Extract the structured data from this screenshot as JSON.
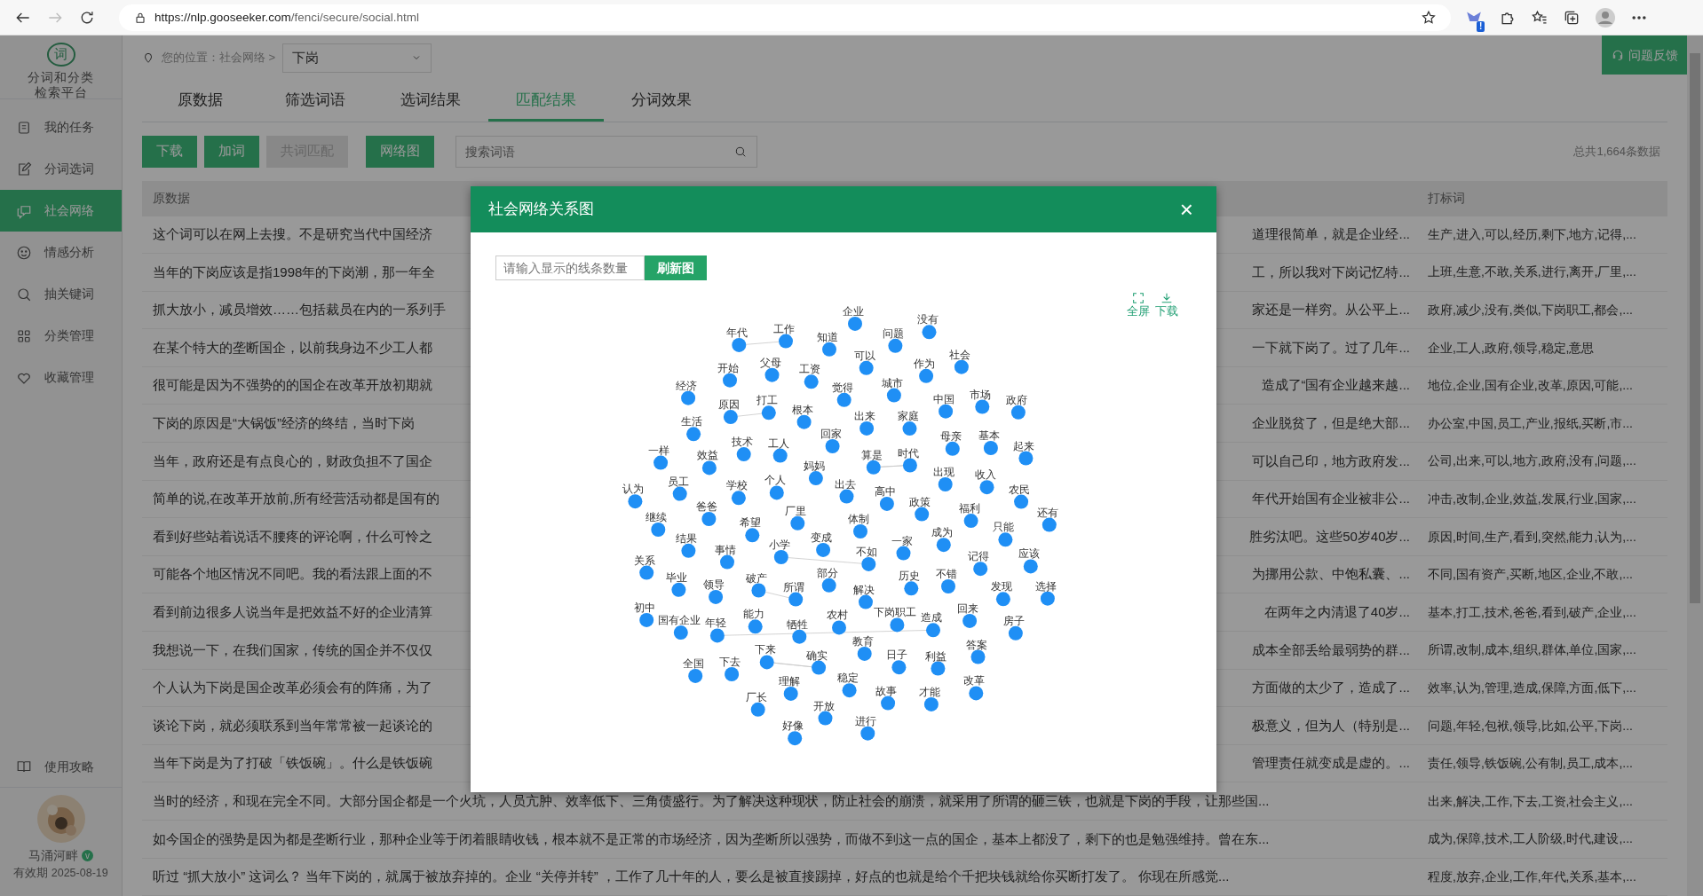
{
  "browser": {
    "url_host": "https://nlp.gooseeker.com",
    "url_path": "/fenci/secure/social.html",
    "badge": "!"
  },
  "sidebar": {
    "logo": "词",
    "title_lines": [
      "分词和分类",
      "检索平台"
    ],
    "items": [
      {
        "label": "我的任务",
        "selected": false
      },
      {
        "label": "分词选词",
        "selected": false
      },
      {
        "label": "社会网络",
        "selected": true
      },
      {
        "label": "情感分析",
        "selected": false
      },
      {
        "label": "抽关键词",
        "selected": false
      },
      {
        "label": "分类管理",
        "selected": false
      },
      {
        "label": "收藏管理",
        "selected": false
      }
    ],
    "help": "使用攻略",
    "user": {
      "name": "马涌河畔",
      "badge": "v",
      "expiry": "有效期 2025-08-19"
    }
  },
  "breadcrumb": {
    "label": "您的位置：社会网络 >",
    "select": "下岗"
  },
  "feedback": "问题反馈",
  "tabs": [
    {
      "label": "原数据",
      "selected": false
    },
    {
      "label": "筛选词语",
      "selected": false
    },
    {
      "label": "选词结果",
      "selected": false
    },
    {
      "label": "匹配结果",
      "selected": true
    },
    {
      "label": "分词效果",
      "selected": false
    }
  ],
  "toolbar": {
    "buttons": [
      {
        "label": "下载",
        "disabled": false
      },
      {
        "label": "加词",
        "disabled": false
      },
      {
        "label": "共词匹配",
        "disabled": true
      },
      {
        "label": "网络图",
        "disabled": false
      }
    ],
    "search_placeholder": "搜索词语",
    "total": "总共1,664条数据"
  },
  "table": {
    "columns": [
      "原数据",
      "打标词"
    ],
    "rows": [
      {
        "text_start": "这个词可以在网上去搜。不是研究当代中国经济",
        "text_end": "道理很简单，就是企业经...",
        "tags": "生产,进入,可以,经历,剩下,地方,记得,..."
      },
      {
        "text_start": "当年的下岗应该是指1998年的下岗潮，那一年全",
        "text_end": "工，所以我对下岗记忆特...",
        "tags": "上班,生意,不敢,关系,进行,离开,厂里,..."
      },
      {
        "text_start": "抓大放小，减员增效……包括裁员在内的一系列手",
        "text_end": "家还是一样穷。从公平上...",
        "tags": "政府,减少,没有,类似,下岗职工,都会,..."
      },
      {
        "text_start": "在某个特大的垄断国企，以前我身边不少工人都",
        "text_end": "一下就下岗了。过了几年...",
        "tags": "企业,工人,政府,领导,稳定,意思"
      },
      {
        "text_start": "很可能是因为不强势的的国企在改革开放初期就",
        "text_end": "造成了“国有企业越来越...",
        "tags": "地位,企业,国有企业,改革,原因,可能,..."
      },
      {
        "text_start": "下岗的原因是“大锅饭”经济的终结，当时下岗",
        "text_end": "企业脱贫了，但是绝大部...",
        "tags": "办公室,中国,员工,产业,报纸,买断,市..."
      },
      {
        "text_start": "当年，政府还是有点良心的，财政负担不了国企",
        "text_end": "可以自己印，地方政府发...",
        "tags": "公司,出来,可以,地方,政府,没有,问题,..."
      },
      {
        "text_start": "简单的说,在改革开放前,所有经营活动都是国有的",
        "text_end": "年代开始国有企业被非公...",
        "tags": "冲击,改制,企业,效益,发展,行业,国家,..."
      },
      {
        "text_start": "看到好些站着说话不腰疼的评论啊，什么可怜之",
        "text_end": "胜劣汰吧。这些50岁40岁...",
        "tags": "原因,时间,生产,看到,突然,能力,认为,..."
      },
      {
        "text_start": "可能各个地区情况不同吧。我的看法跟上面的不",
        "text_end": "为挪用公款、中饱私囊、...",
        "tags": "不同,国有资产,买断,地区,企业,不敢,..."
      },
      {
        "text_start": "看到前边很多人说当年是把效益不好的企业清算",
        "text_end": "在两年之内清退了40岁...",
        "tags": "基本,打工,技术,爸爸,看到,破产,企业,..."
      },
      {
        "text_start": "我想说一下，在我们国家，传统的国企并不仅仅",
        "text_end": "成本全部丢给最弱势的群...",
        "tags": "所谓,改制,成本,组织,群体,单位,国家,..."
      },
      {
        "text_start": "个人认为下岗是国企改革必须会有的阵痛，为了",
        "text_end": "方面做的太少了，造成了...",
        "tags": "效率,认为,管理,造成,保障,方面,低下,..."
      },
      {
        "text_start": "谈论下岗，就必须联系到当年常常被一起谈论的",
        "text_end": "极意义，但为人（特别是...",
        "tags": "问题,年轻,包袱,领导,比如,公平,下岗..."
      },
      {
        "text_start": "当年下岗是为了打破「铁饭碗」。什么是铁饭碗",
        "text_end": "管理责任就变成是虚的。...",
        "tags": "责任,领导,铁饭碗,公有制,员工,成本,..."
      },
      {
        "text": "当时的经济，和现在完全不同。大部分国企都是一个火坑，人员亢肿、效率低下、三角债盛行。为了解决这种现状，防止社会的崩溃，就采用了所谓的砸三铁，也就是下岗的手段，让那些国...",
        "tags": "出来,解决,工作,下去,工资,社会主义,..."
      },
      {
        "text": "如今国企的强势是因为都是垄断行业，那种企业等于闭着眼睛收钱，根本就不是正常的市场经济，因为垄断所以强势，而做不到这一点的国企，基本上都没了，剩下的也是勉强维持。曾在东...",
        "tags": "成为,保障,技术,工人阶级,时代,建设,..."
      },
      {
        "text": "听过 “抓大放小” 这词么？ 当年下岗的，就属于被放弃掉的。企业 “关停并转” ，工作了几十年的人，要么是被直接踢掉，好点的也就是给个千把块钱就给你买断打发了。 你现在所感觉...",
        "tags": "程度,放弃,企业,工作,年代,关系,基本,..."
      }
    ]
  },
  "modal": {
    "title": "社会网络关系图",
    "close": "×",
    "input_placeholder": "请输入显示的线条数量",
    "refresh": "刷新图",
    "actions": [
      "全屏",
      "下载"
    ],
    "graph": {
      "nodes": [
        "工作",
        "企业",
        "没有",
        "年代",
        "知道",
        "可以",
        "问题",
        "社会",
        "经济",
        "开始",
        "父母",
        "工资",
        "觉得",
        "城市",
        "作为",
        "原因",
        "打工",
        "根本",
        "出来",
        "家庭",
        "中国",
        "市场",
        "政府",
        "生活",
        "技术",
        "工人",
        "回家",
        "母亲",
        "基本",
        "起来",
        "一样",
        "效益",
        "妈妈",
        "算是",
        "时代",
        "出现",
        "收入",
        "认为",
        "员工",
        "爸爸",
        "学校",
        "个人",
        "出去",
        "高中",
        "政策",
        "福利",
        "农民",
        "继续",
        "结果",
        "希望",
        "厂里",
        "变成",
        "体制",
        "成为",
        "只能",
        "还有",
        "关系",
        "事情",
        "小学",
        "不如",
        "一家",
        "记得",
        "应该",
        "毕业",
        "领导",
        "破产",
        "所谓",
        "部分",
        "解决",
        "历史",
        "不错",
        "发现",
        "选择",
        "初中",
        "国有企业",
        "年轻",
        "能力",
        "牺牲",
        "农村",
        "下岗职工",
        "造成",
        "回来",
        "房子",
        "下来",
        "确实",
        "教育",
        "日子",
        "利益",
        "答案",
        "全国",
        "下去",
        "理解",
        "稳定",
        "故事",
        "改革",
        "厂长",
        "开放",
        "进行",
        "才能",
        "好像"
      ]
    }
  }
}
